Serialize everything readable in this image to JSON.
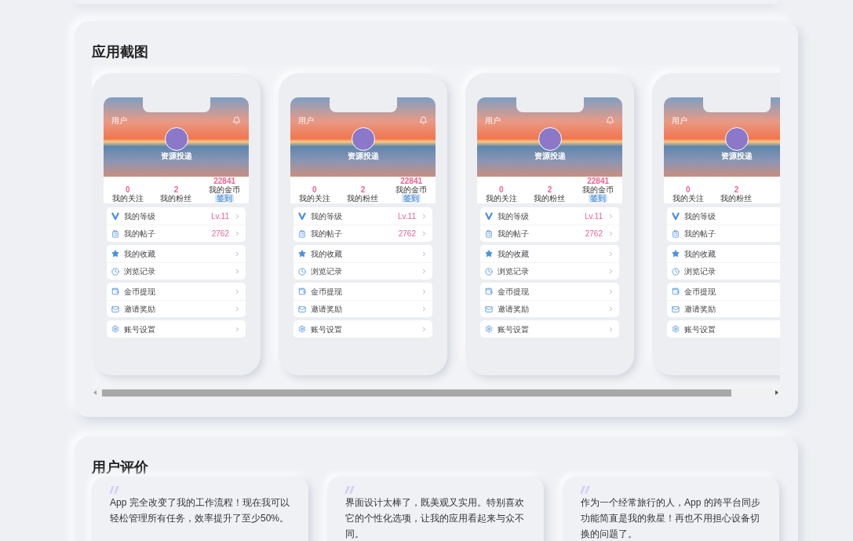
{
  "screenshots_section": {
    "title": "应用截图",
    "screenshots": [
      {
        "header_title": "用户",
        "bell": true,
        "username": "资源投递",
        "stats": [
          {
            "value": "0",
            "label": "我的关注"
          },
          {
            "value": "2",
            "label": "我的粉丝"
          },
          {
            "value": "22841",
            "label": "我的金币",
            "badge": "签到"
          }
        ],
        "groups": [
          [
            {
              "kind": "level",
              "label": "我的等级",
              "value": "Lv.11"
            },
            {
              "kind": "posts",
              "label": "我的帖子",
              "value": "2762"
            }
          ],
          [
            {
              "kind": "favorites",
              "label": "我的收藏"
            },
            {
              "kind": "history",
              "label": "浏览记录"
            }
          ],
          [
            {
              "kind": "wallet",
              "label": "金币提现"
            },
            {
              "kind": "invite",
              "label": "邀请奖励"
            }
          ],
          [
            {
              "kind": "settings",
              "label": "账号设置"
            }
          ]
        ]
      },
      {
        "header_title": "用户",
        "bell": true,
        "username": "资源投递",
        "stats": [
          {
            "value": "0",
            "label": "我的关注"
          },
          {
            "value": "2",
            "label": "我的粉丝"
          },
          {
            "value": "22841",
            "label": "我的金币",
            "badge": "签到"
          }
        ],
        "groups": [
          [
            {
              "kind": "level",
              "label": "我的等级",
              "value": "Lv.11"
            },
            {
              "kind": "posts",
              "label": "我的帖子",
              "value": "2762"
            }
          ],
          [
            {
              "kind": "favorites",
              "label": "我的收藏"
            },
            {
              "kind": "history",
              "label": "浏览记录"
            }
          ],
          [
            {
              "kind": "wallet",
              "label": "金币提现"
            },
            {
              "kind": "invite",
              "label": "邀请奖励"
            }
          ],
          [
            {
              "kind": "settings",
              "label": "账号设置"
            }
          ]
        ]
      },
      {
        "header_title": "用户",
        "bell": true,
        "username": "资源投递",
        "stats": [
          {
            "value": "0",
            "label": "我的关注"
          },
          {
            "value": "2",
            "label": "我的粉丝"
          },
          {
            "value": "22841",
            "label": "我的金币",
            "badge": "签到"
          }
        ],
        "groups": [
          [
            {
              "kind": "level",
              "label": "我的等级",
              "value": "Lv.11"
            },
            {
              "kind": "posts",
              "label": "我的帖子",
              "value": "2762"
            }
          ],
          [
            {
              "kind": "favorites",
              "label": "我的收藏"
            },
            {
              "kind": "history",
              "label": "浏览记录"
            }
          ],
          [
            {
              "kind": "wallet",
              "label": "金币提现"
            },
            {
              "kind": "invite",
              "label": "邀请奖励"
            }
          ],
          [
            {
              "kind": "settings",
              "label": "账号设置"
            }
          ]
        ]
      },
      {
        "header_title": "用户",
        "bell": false,
        "username": "资源投递",
        "stats": [
          {
            "value": "0",
            "label": "我的关注"
          },
          {
            "value": "2",
            "label": "我的粉丝"
          }
        ],
        "groups": [
          [
            {
              "kind": "level",
              "label": "我的等级"
            },
            {
              "kind": "posts",
              "label": "我的帖子"
            }
          ],
          [
            {
              "kind": "favorites",
              "label": "我的收藏"
            },
            {
              "kind": "history",
              "label": "浏览记录"
            }
          ],
          [
            {
              "kind": "wallet",
              "label": "金币提现"
            },
            {
              "kind": "invite",
              "label": "邀请奖励"
            }
          ],
          [
            {
              "kind": "settings",
              "label": "账号设置"
            }
          ]
        ]
      }
    ]
  },
  "reviews_section": {
    "title": "用户评价",
    "reviews": [
      {
        "text": "App 完全改变了我的工作流程！现在我可以轻松管理所有任务，效率提升了至少50%。"
      },
      {
        "text": "界面设计太棒了，既美观又实用。特别喜欢它的个性化选项，让我的应用看起来与众不同。"
      },
      {
        "text": "作为一个经常旅行的人，App 的跨平台同步功能简直是我的救星！再也不用担心设备切换的问题了。"
      }
    ]
  }
}
